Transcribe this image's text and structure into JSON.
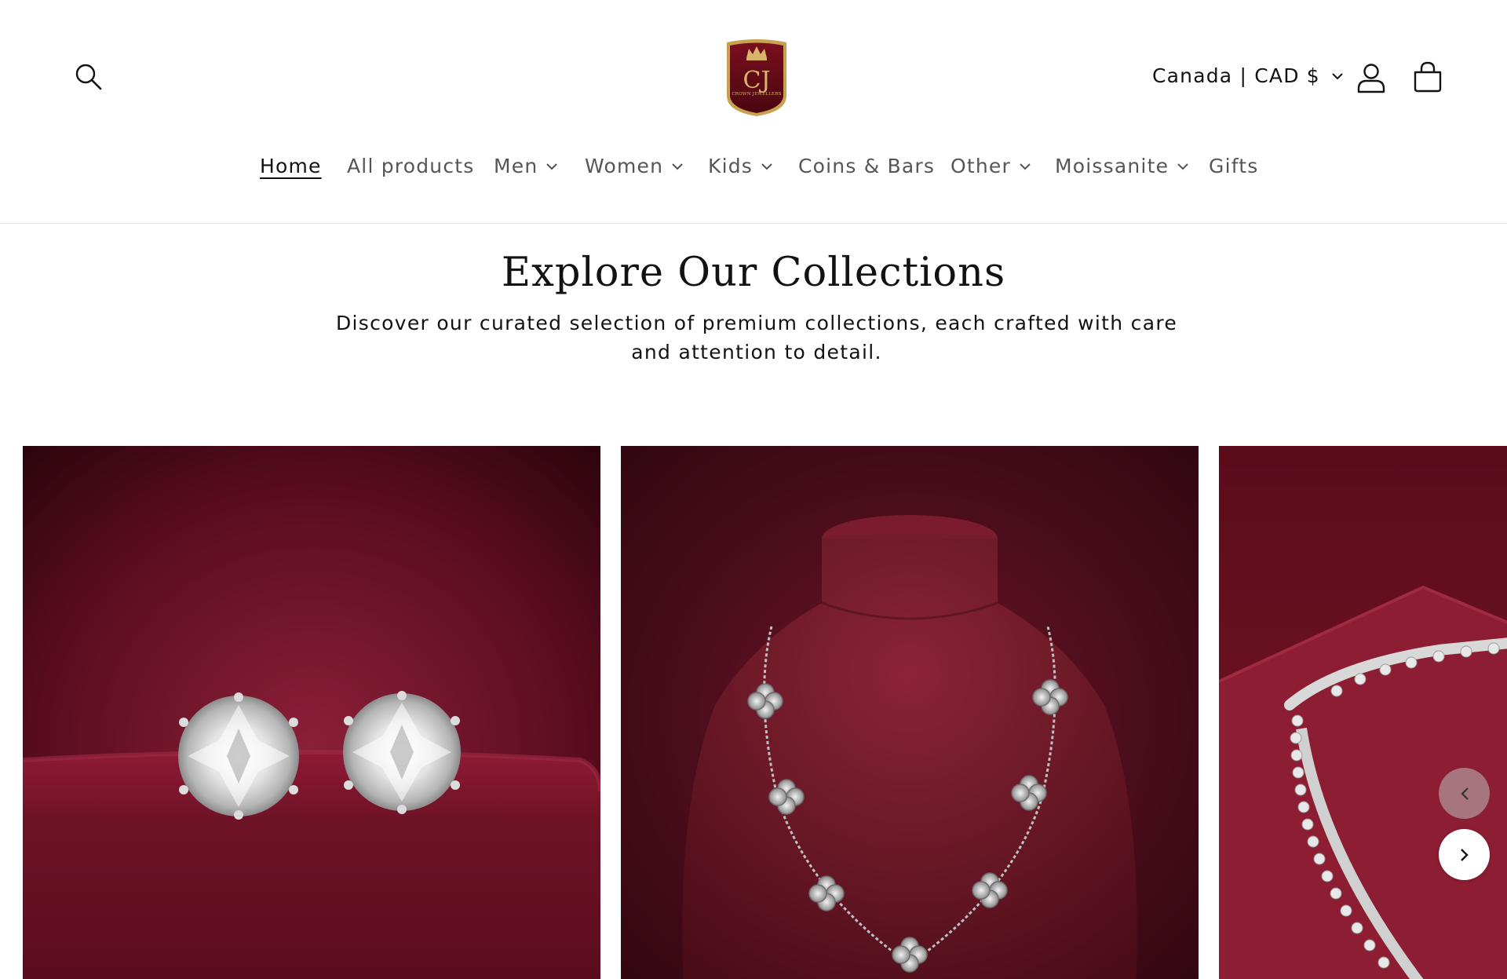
{
  "header": {
    "logo_text": "CROWN JEWELLERS",
    "logo_monogram": "CJ",
    "locale_label": "Canada | CAD $",
    "icons": {
      "search": "search-icon",
      "account": "user-icon",
      "cart": "cart-icon",
      "locale_chevron": "chevron-down-icon"
    }
  },
  "nav": {
    "items": [
      {
        "label": "Home",
        "has_dropdown": false,
        "active": true
      },
      {
        "label": "All products",
        "has_dropdown": false,
        "active": false
      },
      {
        "label": "Men",
        "has_dropdown": true,
        "active": false
      },
      {
        "label": "Women",
        "has_dropdown": true,
        "active": false
      },
      {
        "label": "Kids",
        "has_dropdown": true,
        "active": false
      },
      {
        "label": "Coins & Bars",
        "has_dropdown": false,
        "active": false
      },
      {
        "label": "Other",
        "has_dropdown": true,
        "active": false
      },
      {
        "label": "Moissanite",
        "has_dropdown": true,
        "active": false
      },
      {
        "label": "Gifts",
        "has_dropdown": false,
        "active": false
      }
    ]
  },
  "collections": {
    "title": "Explore Our Collections",
    "description": "Discover our curated selection of premium collections, each crafted with care and attention to detail.",
    "cards": [
      {
        "image": "diamond stud earrings on burgundy velvet"
      },
      {
        "image": "silver clover necklace on burgundy bust"
      },
      {
        "image": "silver anklet on burgundy velvet box"
      }
    ],
    "slider_icons": {
      "prev": "chevron-left-icon",
      "next": "chevron-right-icon"
    }
  },
  "colors": {
    "burgundy_dark": "#3d0612",
    "burgundy": "#7a1a2e",
    "text": "#121212",
    "nav_text": "#555555",
    "logo_gold": "#d9b56a"
  }
}
